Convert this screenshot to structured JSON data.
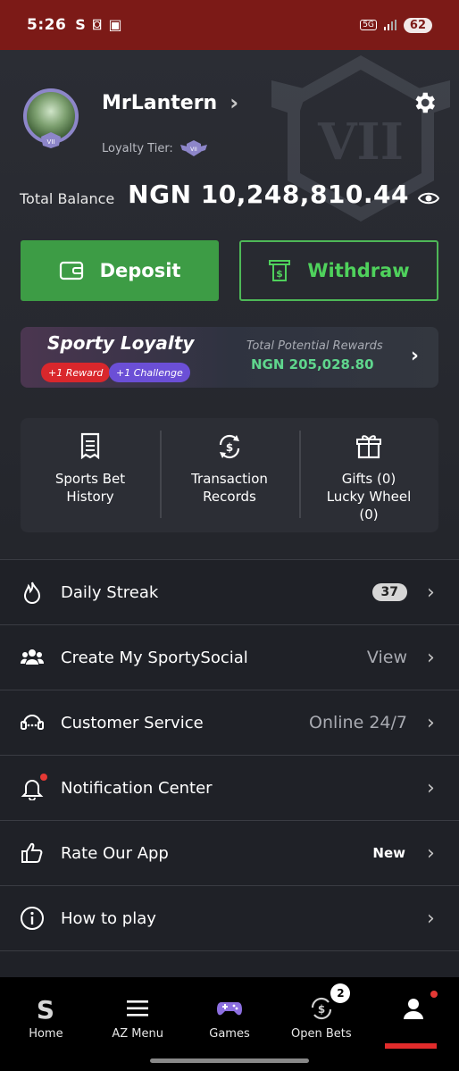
{
  "status_bar": {
    "time": "5:26",
    "network": "5G",
    "battery": "62"
  },
  "profile": {
    "username": "MrLantern",
    "loyalty_tier_label": "Loyalty Tier:",
    "tier_badge": "VII",
    "total_balance_label": "Total Balance",
    "total_balance_value": "NGN 10,248,810.44"
  },
  "actions": {
    "deposit_label": "Deposit",
    "withdraw_label": "Withdraw"
  },
  "loyalty": {
    "title": "Sporty Loyalty",
    "reward_pill": "+1 Reward",
    "challenge_pill": "+1 Challenge",
    "rewards_label": "Total Potential Rewards",
    "rewards_value": "NGN 205,028.80"
  },
  "quick_links": [
    {
      "label_1": "Sports Bet",
      "label_2": "History",
      "icon": "receipt-icon"
    },
    {
      "label_1": "Transaction",
      "label_2": "Records",
      "icon": "dollar-cycle-icon"
    },
    {
      "label_1": "Gifts (0)",
      "label_2": "Lucky Wheel",
      "label_3": "(0)",
      "icon": "gift-icon"
    }
  ],
  "menu": [
    {
      "label": "Daily Streak",
      "badge": "37",
      "icon": "flame-icon"
    },
    {
      "label": "Create My SportySocial",
      "meta": "View",
      "icon": "group-icon"
    },
    {
      "label": "Customer Service",
      "meta": "Online 24/7",
      "icon": "headset-icon"
    },
    {
      "label": "Notification Center",
      "icon": "bell-icon"
    },
    {
      "label": "Rate Our App",
      "new": "New",
      "icon": "thumbs-up-icon"
    },
    {
      "label": "How to play",
      "icon": "info-icon"
    }
  ],
  "bottom_nav": [
    {
      "label": "Home",
      "icon": "sporty-logo-icon"
    },
    {
      "label": "AZ Menu",
      "icon": "hamburger-icon"
    },
    {
      "label": "Games",
      "icon": "gamepad-icon"
    },
    {
      "label": "Open Bets",
      "icon": "open-bets-icon",
      "count": "2"
    },
    {
      "label": "",
      "icon": "person-icon"
    }
  ],
  "colors": {
    "accent_green": "#3d9c45",
    "withdraw_green": "#4fd15c",
    "status_red": "#7c1a17",
    "active_red": "#e12b2b",
    "rewards_green": "#5fd68d"
  }
}
